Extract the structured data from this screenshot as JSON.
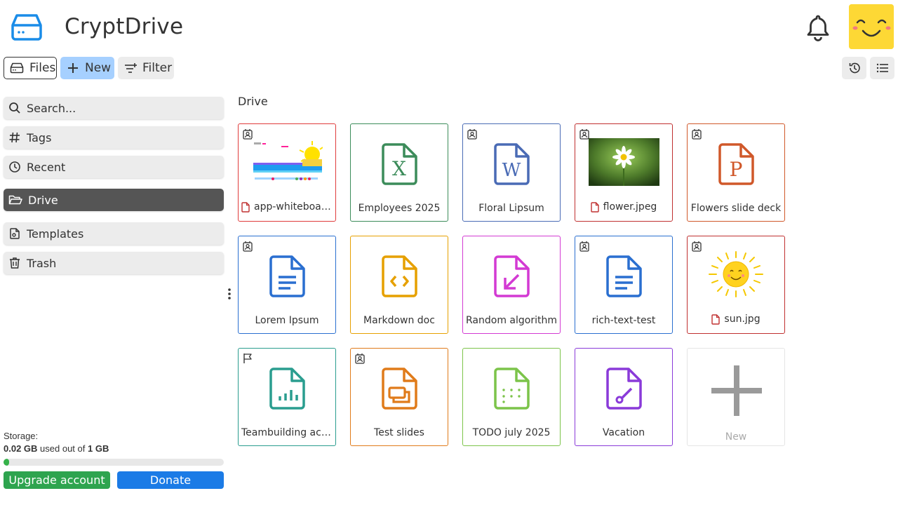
{
  "header": {
    "title": "CryptDrive"
  },
  "toolbar": {
    "files_label": "Files",
    "new_label": "New",
    "filter_label": "Filter"
  },
  "sidebar": {
    "items": [
      {
        "label": "Search..."
      },
      {
        "label": "Tags"
      },
      {
        "label": "Recent"
      },
      {
        "label": "Drive"
      },
      {
        "label": "Templates"
      },
      {
        "label": "Trash"
      }
    ]
  },
  "storage": {
    "label": "Storage:",
    "used": "0.02 GB",
    "middle_text": " used out of ",
    "total": "1 GB",
    "fraction": 0.02,
    "upgrade_label": "Upgrade account",
    "donate_label": "Donate"
  },
  "main": {
    "section_label": "Drive",
    "files": [
      {
        "name": "app-whiteboar...",
        "type": "whiteboard",
        "color": "#e03c3c"
      },
      {
        "name": "Employees 2025",
        "type": "sheet",
        "color": "#3c8c5a"
      },
      {
        "name": "Floral Lipsum",
        "type": "word",
        "color": "#4a6bb5"
      },
      {
        "name": "flower.jpeg",
        "type": "image",
        "color": "#c03030"
      },
      {
        "name": "Flowers slide deck",
        "type": "presentation",
        "color": "#d0582a"
      },
      {
        "name": "Lorem Ipsum",
        "type": "doc",
        "color": "#2a6fd0"
      },
      {
        "name": "Markdown doc",
        "type": "code",
        "color": "#e6a000"
      },
      {
        "name": "Random algorithm",
        "type": "diagram",
        "color": "#d33ad3"
      },
      {
        "name": "rich-text-test",
        "type": "doc",
        "color": "#2a6fd0"
      },
      {
        "name": "sun.jpg",
        "type": "image",
        "color": "#c03030"
      },
      {
        "name": "Teambuilding acti...",
        "type": "form",
        "color": "#2a9d8f"
      },
      {
        "name": "Test slides",
        "type": "slides",
        "color": "#e07b1a"
      },
      {
        "name": "TODO july 2025",
        "type": "kanban",
        "color": "#7cc44a"
      },
      {
        "name": "Vacation",
        "type": "drawing",
        "color": "#8a3ad9"
      },
      {
        "name": "New",
        "type": "new",
        "color": "#999999"
      }
    ]
  }
}
